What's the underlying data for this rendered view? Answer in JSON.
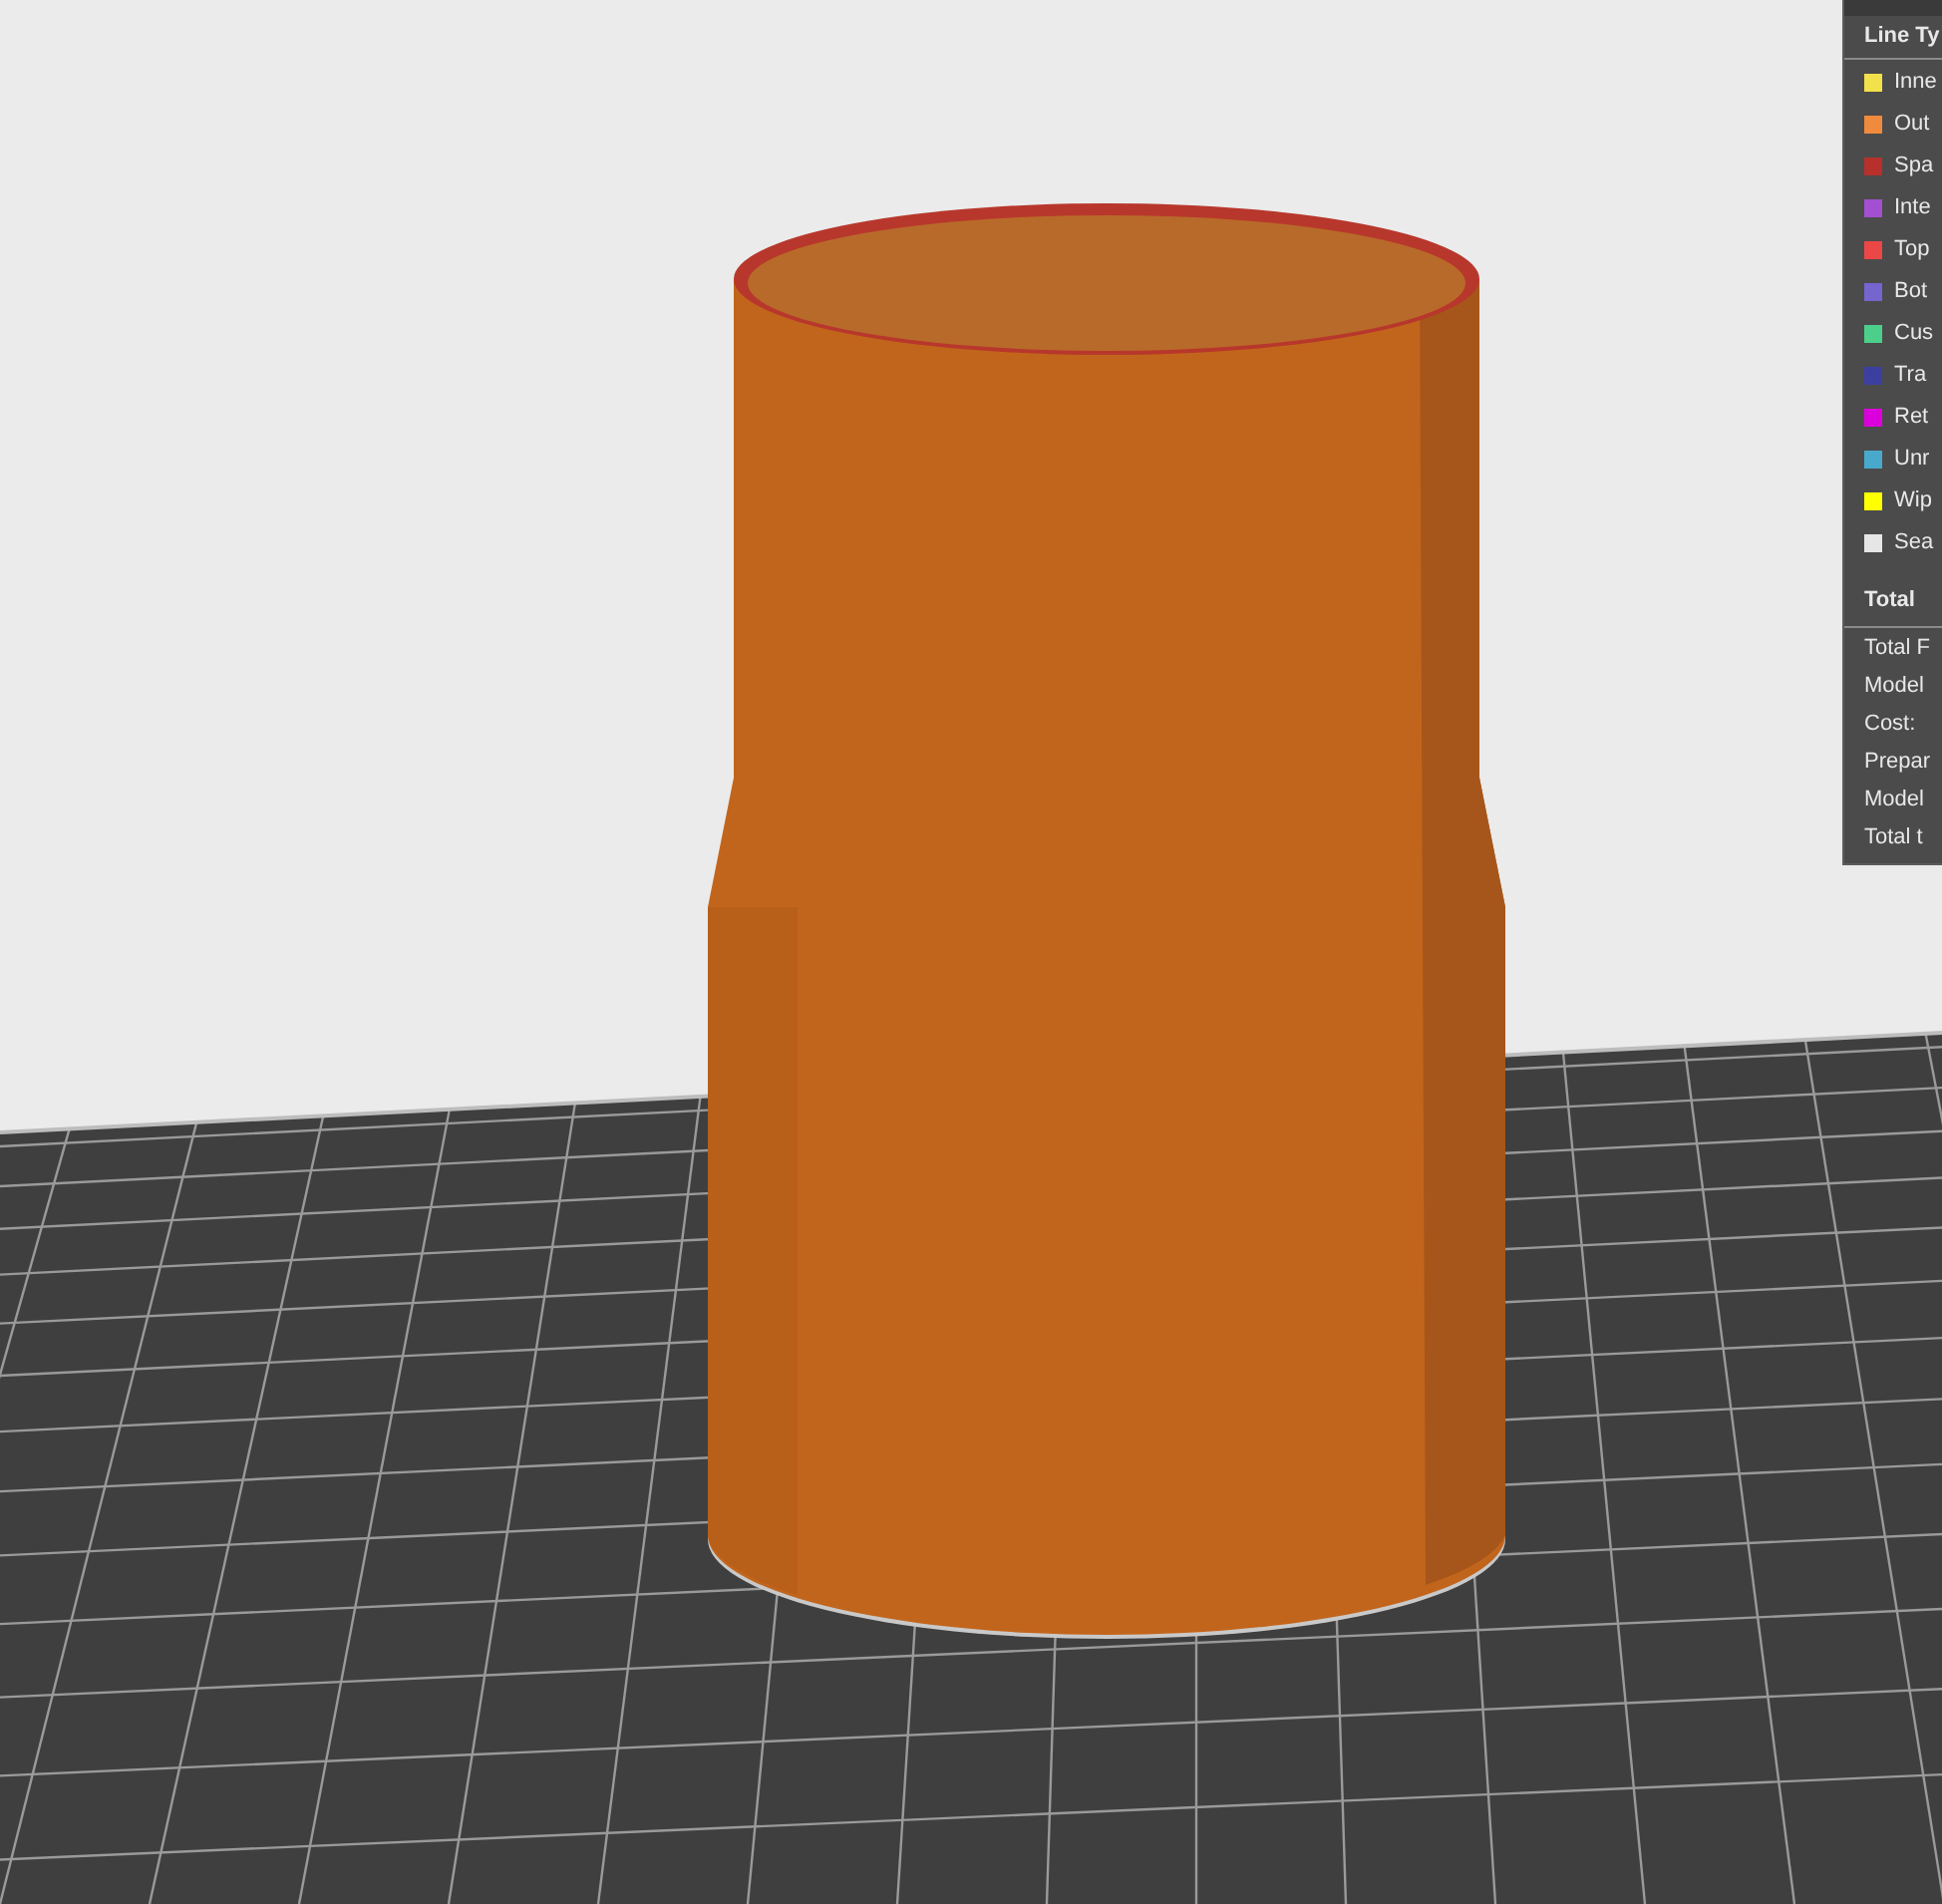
{
  "legend": {
    "title": "Line Ty",
    "items": [
      {
        "label": "Inne",
        "color": "#f2e14a"
      },
      {
        "label": "Out",
        "color": "#f08a3c"
      },
      {
        "label": "Spa",
        "color": "#b7302b"
      },
      {
        "label": "Inte",
        "color": "#a24fd1"
      },
      {
        "label": "Top",
        "color": "#ec4747"
      },
      {
        "label": "Bot",
        "color": "#7465cf"
      },
      {
        "label": "Cus",
        "color": "#4ccf8b"
      },
      {
        "label": "Tra",
        "color": "#3d3fa0"
      },
      {
        "label": "Ret",
        "color": "#db00db"
      },
      {
        "label": "Unr",
        "color": "#48a9cc"
      },
      {
        "label": "Wip",
        "color": "#ffff00"
      },
      {
        "label": "Sea",
        "color": "#e6e6e6"
      }
    ]
  },
  "summary": {
    "title": "Total",
    "rows": [
      "Total F",
      "Model",
      "Cost:",
      "Prepar",
      "Model",
      "Total t"
    ]
  }
}
